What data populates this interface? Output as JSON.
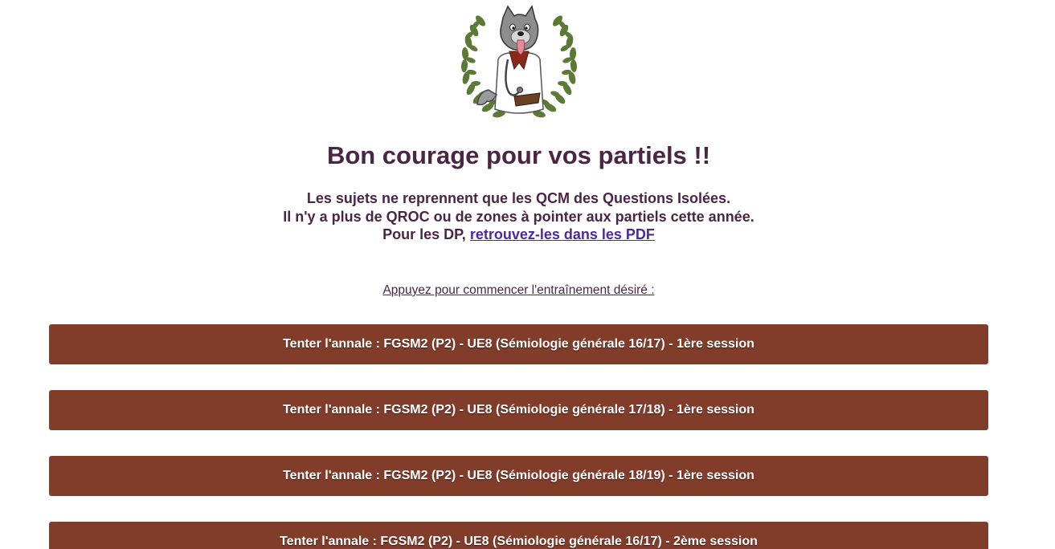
{
  "logo": {
    "icon": "wolf-doctor-laurel-logo",
    "colors": {
      "laurel": "#5b7a35",
      "fur": "#8d8d8d",
      "coat": "#ffffff",
      "scarf": "#8a2b1a",
      "tongue": "#e58a98"
    }
  },
  "title": "Bon courage pour vos partiels !!",
  "info": {
    "line1": "Les sujets ne reprennent que les QCM des Questions Isolées.",
    "line2": "Il n'y a plus de QROC ou de zones à pointer aux partiels cette année.",
    "line3_prefix": "Pour les DP,",
    "line3_link": "retrouvez-les dans les PDF"
  },
  "prompt": "Appuyez pour commencer l'entraînement désiré :",
  "exams": [
    {
      "label": "Tenter l'annale : FGSM2 (P2) - UE8 (Sémiologie générale 16/17) - 1ère session"
    },
    {
      "label": "Tenter l'annale : FGSM2 (P2) - UE8 (Sémiologie générale 17/18) - 1ère session"
    },
    {
      "label": "Tenter l'annale : FGSM2 (P2) - UE8 (Sémiologie générale 18/19) - 1ère session"
    },
    {
      "label": "Tenter l'annale : FGSM2 (P2) - UE8 (Sémiologie générale 16/17) - 2ème session"
    }
  ],
  "colors": {
    "button_bg": "#823c2a",
    "title_text": "#4a2544",
    "link": "#4b2aa0"
  }
}
